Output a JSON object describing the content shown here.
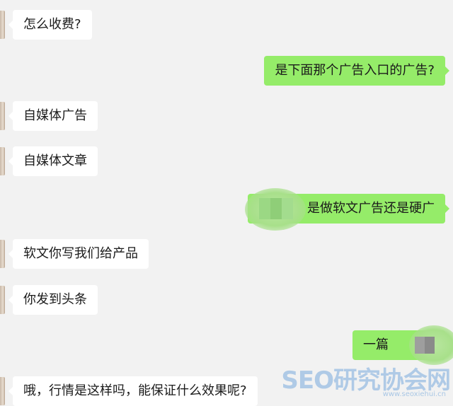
{
  "messages": [
    {
      "side": "left",
      "text": "怎么收费?"
    },
    {
      "side": "right",
      "text": "是下面那个广告入口的广告?"
    },
    {
      "side": "left",
      "text": "自媒体广告"
    },
    {
      "side": "left",
      "text": "自媒体文章"
    },
    {
      "side": "right",
      "text": "是做软文广告还是硬广"
    },
    {
      "side": "left",
      "text": "软文你写我们给产品"
    },
    {
      "side": "left",
      "text": "你发到头条"
    },
    {
      "side": "right",
      "text": "一篇"
    },
    {
      "side": "left",
      "text": "哦，行情是这样吗，能保证什么效果呢?"
    }
  ],
  "watermark": {
    "main": "SEO研究协会网",
    "sub": "www.seoxiehui.cn"
  }
}
